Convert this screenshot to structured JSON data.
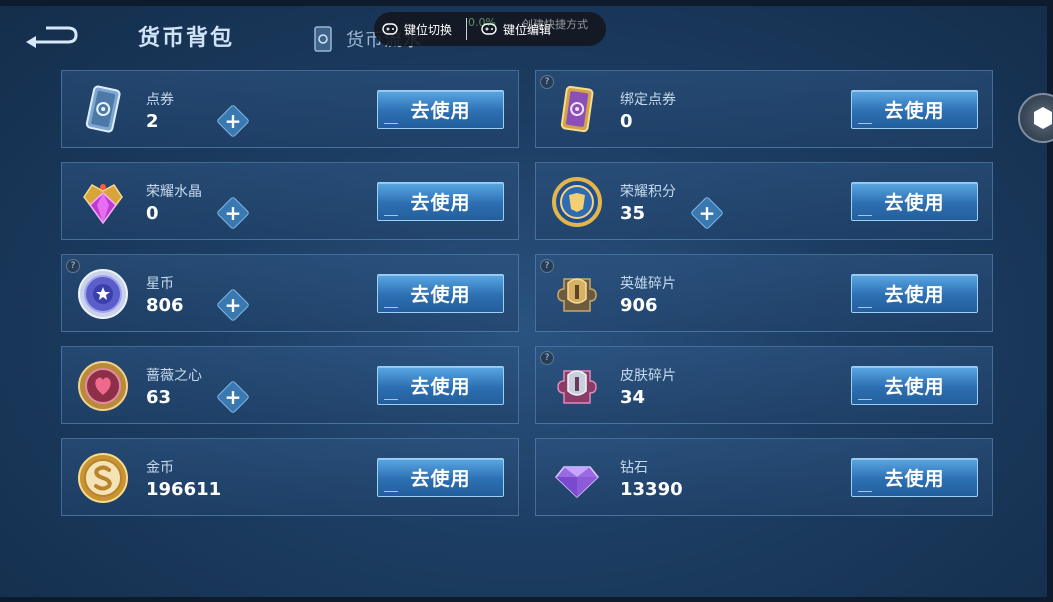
{
  "header": {
    "title": "货币背包",
    "tab_flow_label": "货币流水"
  },
  "overlay": {
    "key_switch_label": "键位切换",
    "key_edit_label": "键位编辑",
    "ghost_percent": "0.0%",
    "ghost_text": "创建快捷方式"
  },
  "use_label": "去使用",
  "currencies": [
    {
      "name": "点券",
      "amount": "2",
      "icon": "voucher-icon",
      "has_plus": true,
      "has_hint": false
    },
    {
      "name": "绑定点券",
      "amount": "0",
      "icon": "bound-voucher-icon",
      "has_plus": false,
      "has_hint": true
    },
    {
      "name": "荣耀水晶",
      "amount": "0",
      "icon": "glory-crystal-icon",
      "has_plus": true,
      "has_hint": false
    },
    {
      "name": "荣耀积分",
      "amount": "35",
      "icon": "glory-points-icon",
      "has_plus": true,
      "has_hint": false
    },
    {
      "name": "星币",
      "amount": "806",
      "icon": "star-coin-icon",
      "has_plus": true,
      "has_hint": true
    },
    {
      "name": "英雄碎片",
      "amount": "906",
      "icon": "hero-fragment-icon",
      "has_plus": false,
      "has_hint": true
    },
    {
      "name": "蔷薇之心",
      "amount": "63",
      "icon": "rose-heart-icon",
      "has_plus": true,
      "has_hint": false
    },
    {
      "name": "皮肤碎片",
      "amount": "34",
      "icon": "skin-fragment-icon",
      "has_plus": false,
      "has_hint": true
    },
    {
      "name": "金币",
      "amount": "196611",
      "icon": "gold-coin-icon",
      "has_plus": false,
      "has_hint": false
    },
    {
      "name": "钻石",
      "amount": "13390",
      "icon": "diamond-icon",
      "has_plus": false,
      "has_hint": false
    }
  ],
  "colors": {
    "button_top": "#5aa7e3",
    "button_bottom": "#245f9c",
    "card_border": "#6ea0d2",
    "background": "#1c3d62"
  }
}
